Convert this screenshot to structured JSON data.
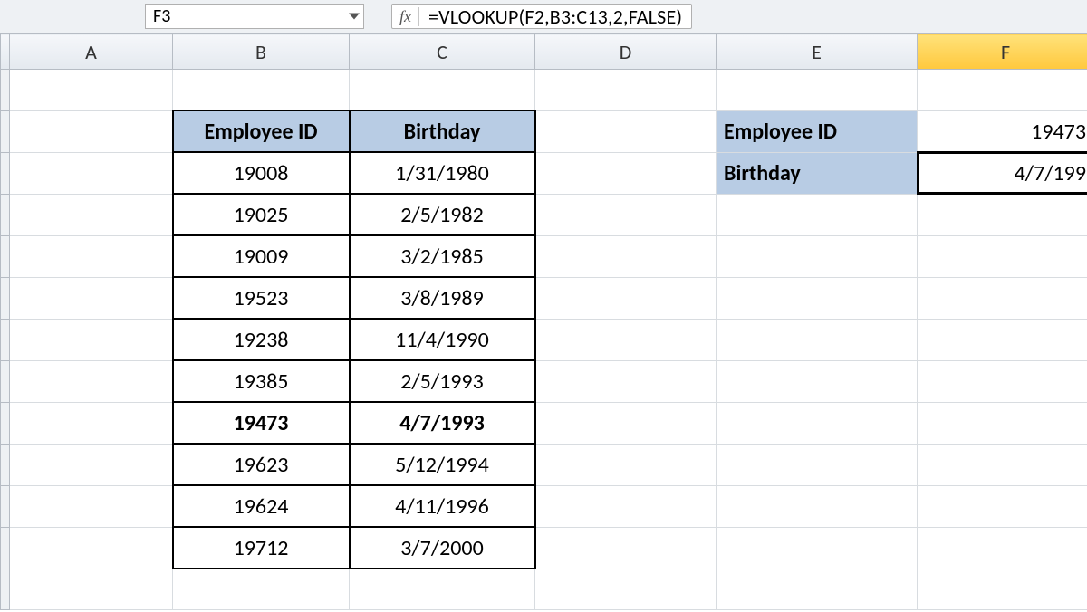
{
  "nameBox": {
    "ref": "F3"
  },
  "formulaBar": {
    "fx": "fx",
    "formula": "=VLOOKUP(F2,B3:C13,2,FALSE)"
  },
  "columns": [
    "A",
    "B",
    "C",
    "D",
    "E",
    "F"
  ],
  "table": {
    "headers": {
      "id": "Employee ID",
      "bday": "Birthday"
    },
    "rows": [
      {
        "id": "19008",
        "bday": "1/31/1980",
        "bold": false
      },
      {
        "id": "19025",
        "bday": "2/5/1982",
        "bold": false
      },
      {
        "id": "19009",
        "bday": "3/2/1985",
        "bold": false
      },
      {
        "id": "19523",
        "bday": "3/8/1989",
        "bold": false
      },
      {
        "id": "19238",
        "bday": "11/4/1990",
        "bold": false
      },
      {
        "id": "19385",
        "bday": "2/5/1993",
        "bold": false
      },
      {
        "id": "19473",
        "bday": "4/7/1993",
        "bold": true
      },
      {
        "id": "19623",
        "bday": "5/12/1994",
        "bold": false
      },
      {
        "id": "19624",
        "bday": "4/11/1996",
        "bold": false
      },
      {
        "id": "19712",
        "bday": "3/7/2000",
        "bold": false
      }
    ]
  },
  "lookup": {
    "idLabel": "Employee ID",
    "idValue": "19473",
    "bdayLabel": "Birthday",
    "bdayValue": "4/7/199"
  },
  "selectedColumn": "F",
  "selectedCell": "F3"
}
